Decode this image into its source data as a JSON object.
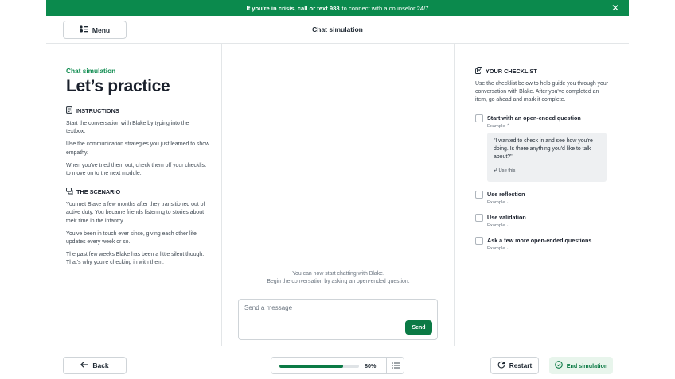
{
  "crisis_banner": {
    "bold": "If you're in crisis, call or text 988",
    "rest": "to connect with a counselor 24/7"
  },
  "header": {
    "menu_label": "Menu",
    "title": "Chat simulation"
  },
  "left": {
    "eyebrow": "Chat simulation",
    "title": "Let’s practice",
    "instructions_heading": "INSTRUCTIONS",
    "instructions": [
      "Start the conversation with Blake by typing into the textbox.",
      "Use the communication strategies you just learned to show empathy.",
      "When you've tried them out, check them off your checklist to move on to the next module."
    ],
    "scenario_heading": "THE SCENARIO",
    "scenario": [
      "You met Blake a few months after they transitioned out of active duty. You became friends listening to stories about their time in the infantry.",
      "You've been in touch ever since, giving each other life updates every week or so.",
      "The past few weeks Blake has been a little silent though. That's why you're checking in with them."
    ]
  },
  "chat": {
    "hint_line1": "You can now start chatting with Blake.",
    "hint_line2": "Begin the conversation by asking an open-ended question.",
    "input_placeholder": "Send a message",
    "input_value": "",
    "send_label": "Send"
  },
  "checklist": {
    "heading": "YOUR CHECKLIST",
    "description": "Use the checklist below to help guide you through your conversation with Blake. After you've completed an item, go ahead and mark it complete.",
    "items": [
      {
        "label": "Start with an open-ended question",
        "example_label": "Example",
        "expanded": true,
        "checked": false,
        "example_text": "\"I wanted to check in and see how you're doing. Is there anything you'd like to talk about?\"",
        "use_this": "Use this"
      },
      {
        "label": "Use reflection",
        "example_label": "Example",
        "expanded": false,
        "checked": false
      },
      {
        "label": "Use validation",
        "example_label": "Example",
        "expanded": false,
        "checked": false
      },
      {
        "label": "Ask a few more open-ended questions",
        "example_label": "Example",
        "expanded": false,
        "checked": false
      }
    ]
  },
  "footer": {
    "back_label": "Back",
    "progress_percent": 80,
    "progress_text": "80%",
    "restart_label": "Restart",
    "end_label": "End simulation"
  },
  "colors": {
    "brand_green": "#0b8a4d",
    "button_green": "#0b7a45",
    "end_button_bg": "#e8f5ec"
  },
  "icons": {
    "banner_close": "close-icon",
    "menu": "menu-icon",
    "instructions": "document-icon",
    "scenario": "chat-bubbles-icon",
    "checklist": "copy-checklist-icon",
    "back": "arrow-left-icon",
    "list": "list-icon",
    "restart": "refresh-icon",
    "end": "check-circle-icon"
  }
}
